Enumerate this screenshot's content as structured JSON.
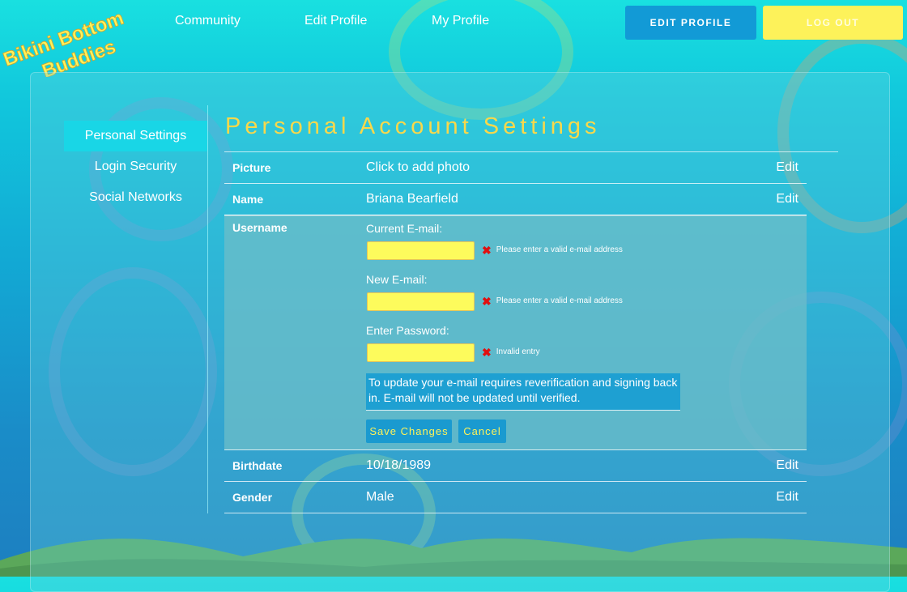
{
  "logo": {
    "line1": "Bikini Bottom",
    "line2": "Buddies"
  },
  "nav": {
    "community": "Community",
    "edit_profile": "Edit Profile",
    "my_profile": "My Profile"
  },
  "header_buttons": {
    "edit_profile": "EDIT PROFILE",
    "log_out": "LOG OUT"
  },
  "sidebar": {
    "items": [
      {
        "label": "Personal Settings",
        "active": true
      },
      {
        "label": "Login Security"
      },
      {
        "label": "Social Networks"
      }
    ]
  },
  "page_title": "Personal Account Settings",
  "rows": {
    "picture": {
      "label": "Picture",
      "value": "Click to add photo",
      "edit": "Edit"
    },
    "name": {
      "label": "Name",
      "value": "Briana Bearfield",
      "edit": "Edit"
    },
    "username": {
      "label": "Username",
      "current_email_label": "Current E-mail:",
      "current_email_error": "Please enter a valid e-mail address",
      "new_email_label": "New E-mail:",
      "new_email_error": "Please enter a valid e-mail address",
      "password_label": "Enter Password:",
      "password_error": "Invalid entry",
      "notice": "To update your e-mail requires reverification and signing back in. E-mail will not be updated until verified.",
      "save_label": "Save Changes",
      "cancel_label": "Cancel"
    },
    "birthdate": {
      "label": "Birthdate",
      "value": "10/18/1989",
      "edit": "Edit"
    },
    "gender": {
      "label": "Gender",
      "value": "Male",
      "edit": "Edit"
    }
  },
  "colors": {
    "accent_yellow": "#fdf25a",
    "title_gold": "#f9d84a",
    "button_blue": "#129ad6",
    "error_red": "#e01010"
  }
}
